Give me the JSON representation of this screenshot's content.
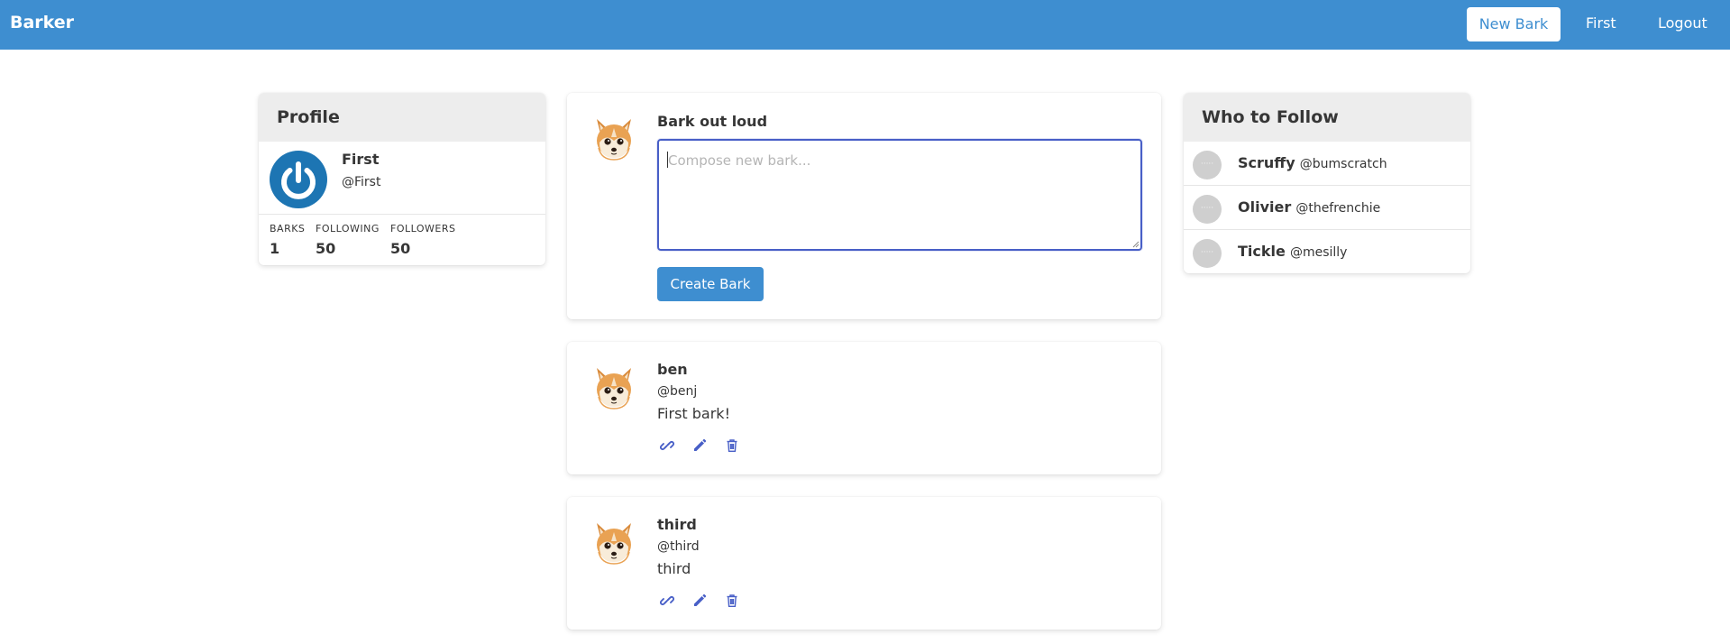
{
  "nav": {
    "brand": "Barker",
    "new_bark": "New Bark",
    "user": "First",
    "logout": "Logout"
  },
  "colors": {
    "primary": "#3e8ed0",
    "focus": "#485fc7",
    "action_icon": "#485fc7",
    "header_bg": "#ededed"
  },
  "profile": {
    "header": "Profile",
    "name": "First",
    "handle": "@First",
    "stats": [
      {
        "label": "BARKS",
        "value": "1"
      },
      {
        "label": "FOLLOWING",
        "value": "50"
      },
      {
        "label": "FOLLOWERS",
        "value": "50"
      }
    ]
  },
  "compose": {
    "title": "Bark out loud",
    "placeholder": "Compose new bark...",
    "value": "",
    "button": "Create Bark"
  },
  "barks": [
    {
      "name": "ben",
      "handle": "@benj",
      "text": "First bark!"
    },
    {
      "name": "third",
      "handle": "@third",
      "text": "third"
    }
  ],
  "action_icons": [
    "link-icon",
    "pencil-icon",
    "trash-icon"
  ],
  "who_to_follow": {
    "header": "Who to Follow",
    "avatar_text": "·····",
    "items": [
      {
        "name": "Scruffy",
        "handle": "@bumscratch"
      },
      {
        "name": "Olivier",
        "handle": "@thefrenchie"
      },
      {
        "name": "Tickle",
        "handle": "@mesilly"
      }
    ]
  }
}
